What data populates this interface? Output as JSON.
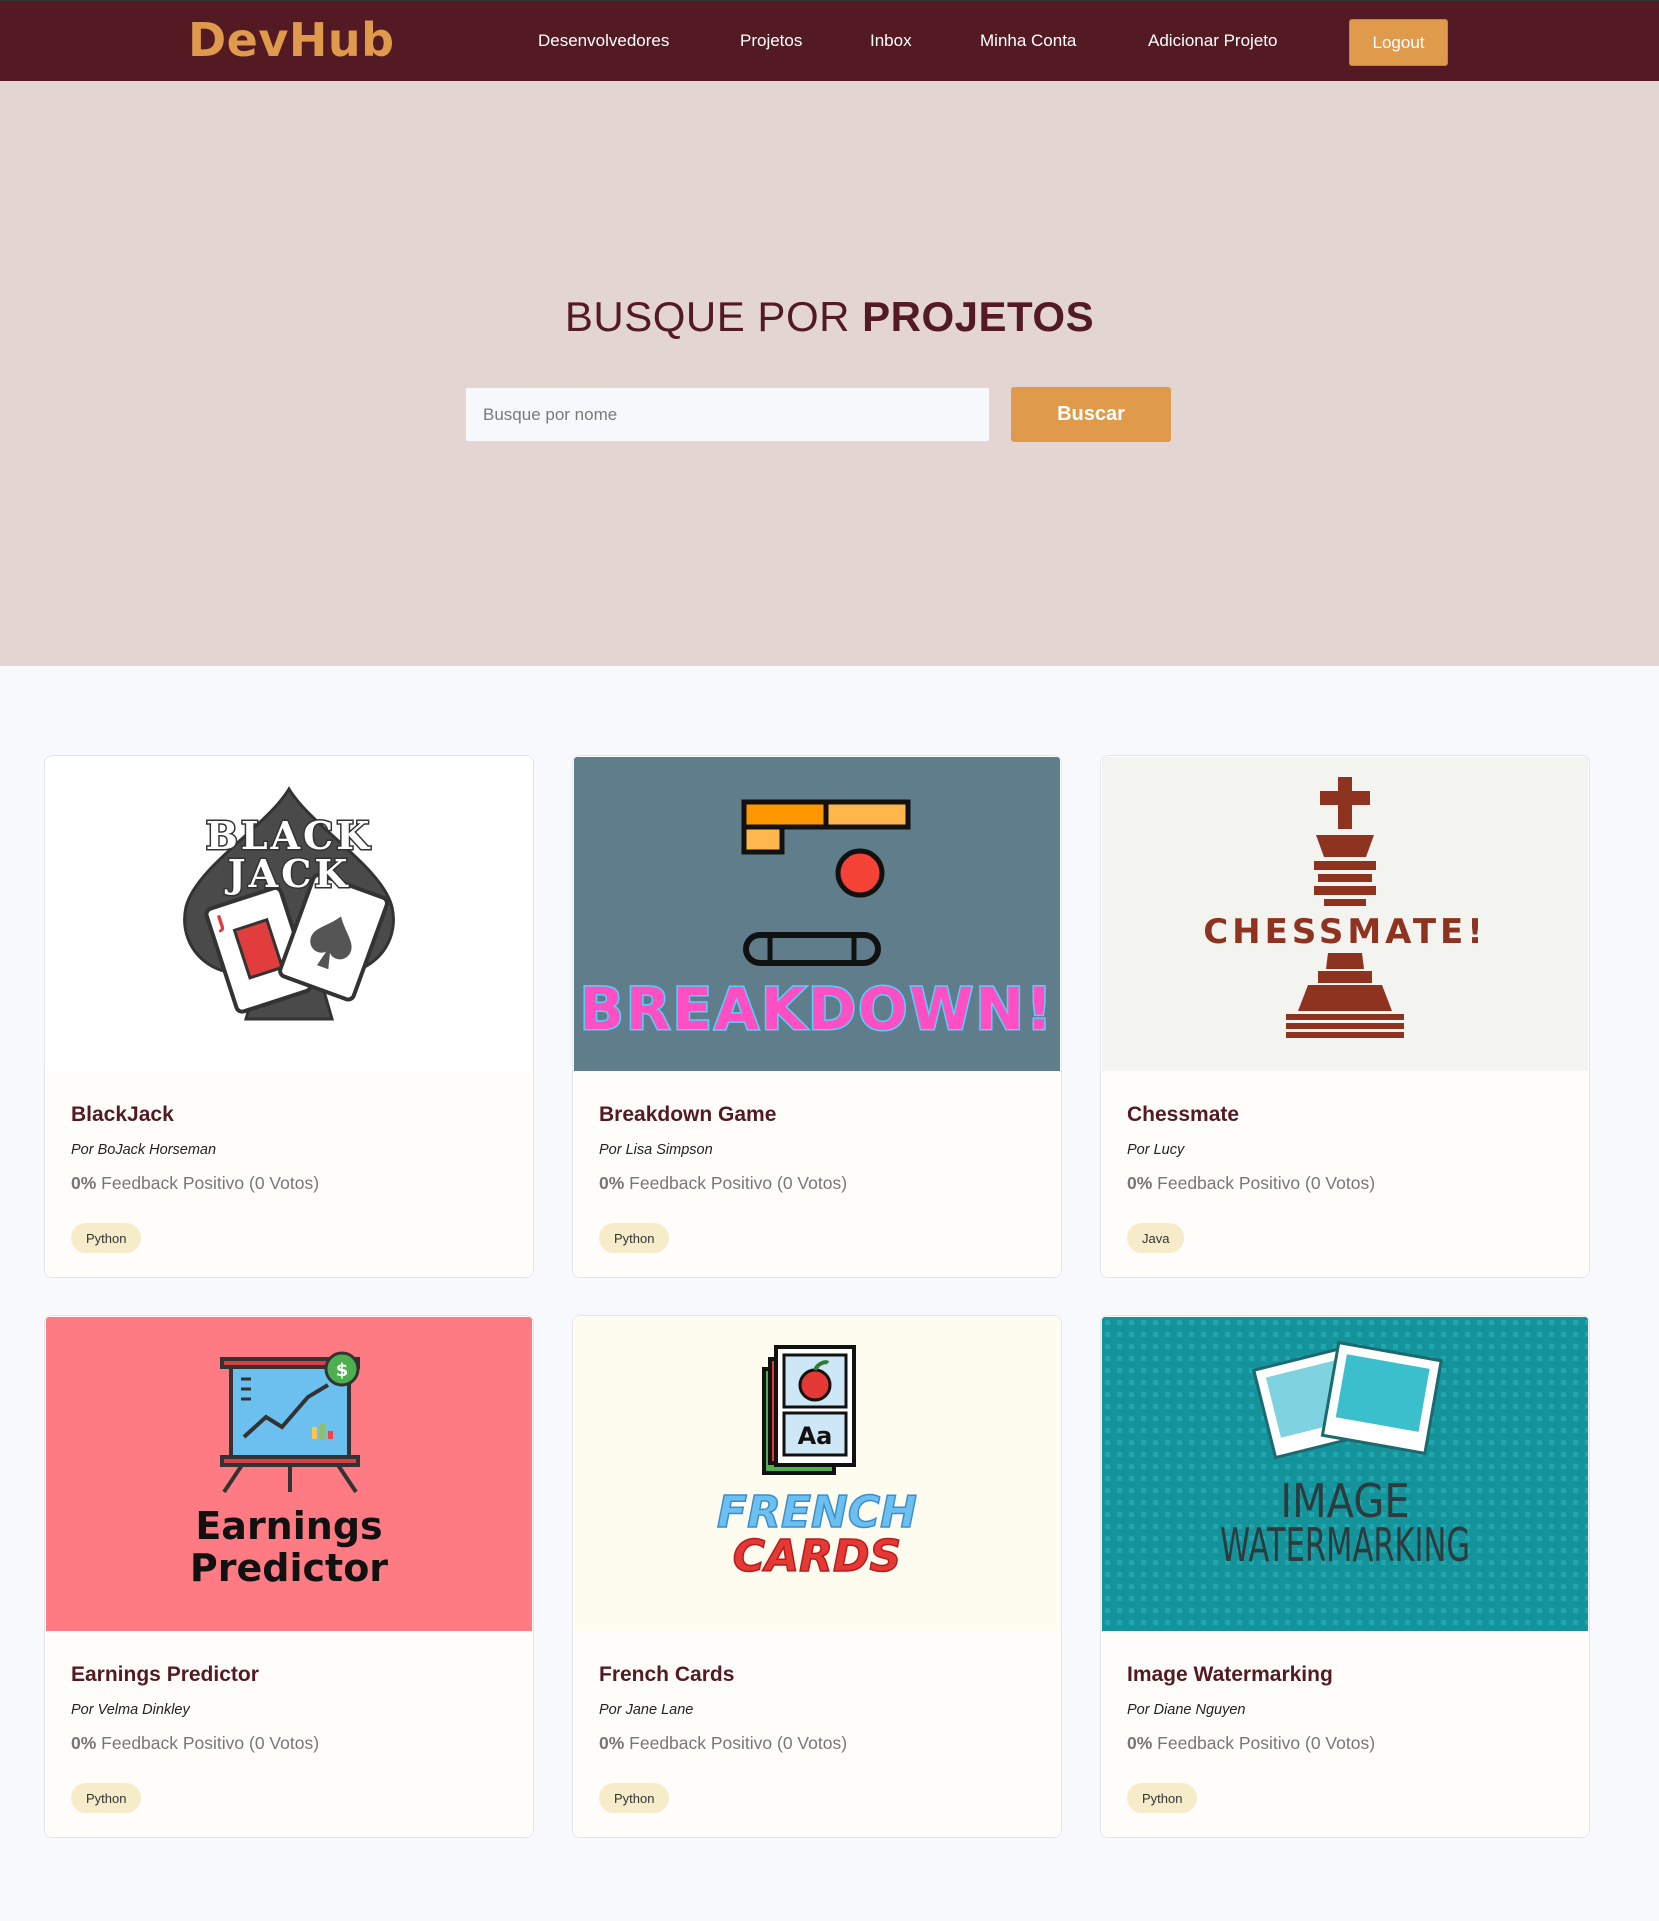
{
  "nav": {
    "logo": "DevHub",
    "links": [
      {
        "label": "Desenvolvedores"
      },
      {
        "label": "Projetos"
      },
      {
        "label": "Inbox"
      },
      {
        "label": "Minha Conta"
      },
      {
        "label": "Adicionar Projeto"
      }
    ],
    "logout_label": "Logout"
  },
  "hero": {
    "title_light": "BUSQUE POR ",
    "title_bold": "PROJETOS",
    "search_placeholder": "Busque por nome",
    "search_button": "Buscar"
  },
  "projects": [
    {
      "title": "BlackJack",
      "author": "Por BoJack Horseman",
      "feedback_pct": "0%",
      "feedback_text": " Feedback Positivo (0 Votos)",
      "tag": "Python",
      "thumb_text": [
        "BLACK",
        "JACK"
      ],
      "thumb_bg": "#ffffff"
    },
    {
      "title": "Breakdown Game",
      "author": "Por Lisa Simpson",
      "feedback_pct": "0%",
      "feedback_text": " Feedback Positivo (0 Votos)",
      "tag": "Python",
      "thumb_text": [
        "BREAKDOWN!"
      ],
      "thumb_bg": "#607d8b"
    },
    {
      "title": "Chessmate",
      "author": "Por Lucy",
      "feedback_pct": "0%",
      "feedback_text": " Feedback Positivo (0 Votos)",
      "tag": "Java",
      "thumb_text": [
        "CHESSMATE!"
      ],
      "thumb_bg": "#f3f3ef"
    },
    {
      "title": "Earnings Predictor",
      "author": "Por Velma Dinkley",
      "feedback_pct": "0%",
      "feedback_text": " Feedback Positivo (0 Votos)",
      "tag": "Python",
      "thumb_text": [
        "Earnings",
        "Predictor"
      ],
      "thumb_bg": "#ff7b83"
    },
    {
      "title": "French Cards",
      "author": "Por Jane Lane",
      "feedback_pct": "0%",
      "feedback_text": " Feedback Positivo (0 Votos)",
      "tag": "Python",
      "thumb_text": [
        "FRENCH",
        "CARDS",
        "Aa"
      ],
      "thumb_bg": "#fefbef"
    },
    {
      "title": "Image Watermarking",
      "author": "Por Diane Nguyen",
      "feedback_pct": "0%",
      "feedback_text": " Feedback Positivo (0 Votos)",
      "tag": "Python",
      "thumb_text": [
        "IMAGE",
        "WATERMARKING"
      ],
      "thumb_bg": "#14939b"
    }
  ],
  "colors": {
    "nav_bg": "#541a24",
    "accent": "#e09a4c",
    "hero_bg": "#e2d5d2",
    "title_color": "#541a24",
    "tag_bg": "#f6ecc9"
  }
}
